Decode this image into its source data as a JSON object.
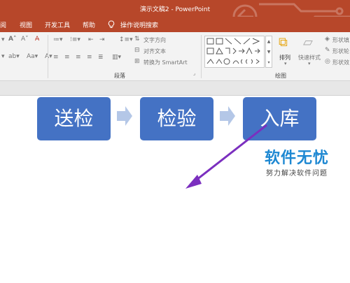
{
  "window": {
    "title": "演示文稿2 - PowerPoint"
  },
  "menu": [
    {
      "label": "阅"
    },
    {
      "label": "视图"
    },
    {
      "label": "开发工具"
    },
    {
      "label": "帮助"
    },
    {
      "label": "操作说明搜索"
    }
  ],
  "ribbon": {
    "paragraph": {
      "text_direction": "文字方向",
      "align_text": "对齐文本",
      "convert_smartart": "转换为 SmartArt",
      "group_label": "段落"
    },
    "drawing": {
      "arrange": "排列",
      "quick_styles": "快速样式",
      "shape_fill": "形状填",
      "shape_outline": "形状轮",
      "shape_effects": "形状效",
      "group_label": "绘图"
    }
  },
  "slide": {
    "boxes": [
      {
        "label": "送检"
      },
      {
        "label": "检验"
      },
      {
        "label": "入库"
      }
    ],
    "colors": {
      "box": "#4472c4",
      "chevron": "#b4c7e7",
      "annotation_arrow": "#7b2fbf"
    }
  },
  "watermark": {
    "title": "软件无忧",
    "subtitle": "努力解决软件问题"
  }
}
